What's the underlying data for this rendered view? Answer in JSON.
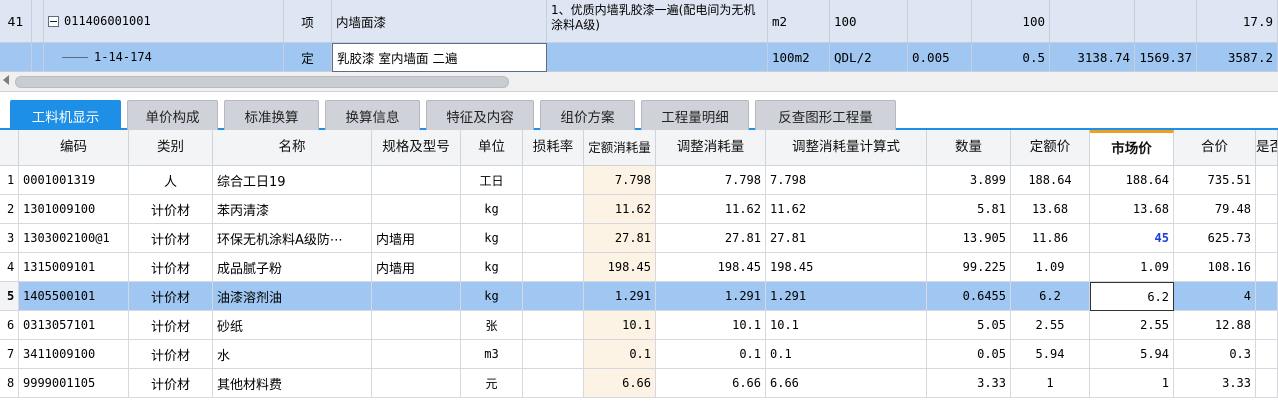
{
  "top_rows": {
    "r41": {
      "rowno": "41",
      "minus": "−",
      "code": "011406001001",
      "kind": "项",
      "name": "内墙面漆",
      "feature": "1、优质内墙乳胶漆一遍(配电间为无机涂料A级)",
      "unit": "m2",
      "qty_expr": "100",
      "qty": "100",
      "total": "17.9"
    },
    "ding": {
      "code": "1-14-174",
      "kind": "定",
      "name": "乳胶漆 室内墙面 二遍",
      "unit": "100m2",
      "qty_expr": "QDL/2",
      "coef": "0.005",
      "qty": "0.5",
      "v1": "3138.74",
      "v2": "1569.37",
      "total": "3587.2"
    }
  },
  "tabs": [
    {
      "label": "工料机显示"
    },
    {
      "label": "单价构成"
    },
    {
      "label": "标准换算"
    },
    {
      "label": "换算信息"
    },
    {
      "label": "特征及内容"
    },
    {
      "label": "组价方案"
    },
    {
      "label": "工程量明细"
    },
    {
      "label": "反查图形工程量"
    }
  ],
  "grid": {
    "headers": {
      "code": "编码",
      "category": "类别",
      "name": "名称",
      "spec": "规格及型号",
      "unit": "单位",
      "loss": "损耗率",
      "quota": "定额消耗量",
      "adj": "调整消耗量",
      "formula": "调整消耗量计算式",
      "qty": "数量",
      "quota_price": "定额价",
      "market_price": "市场价",
      "amount": "合价",
      "extra": "是否"
    },
    "rows": [
      {
        "no": "1",
        "code": "0001001319",
        "category": "人",
        "name": "综合工日19",
        "spec": "",
        "unit": "工日",
        "loss": "",
        "quota": "7.798",
        "adj": "7.798",
        "formula": "7.798",
        "qty": "3.899",
        "quota_price": "188.64",
        "market_price": "188.64",
        "amount": "735.51"
      },
      {
        "no": "2",
        "code": "1301009100",
        "category": "计价材",
        "name": "苯丙清漆",
        "spec": "",
        "unit": "kg",
        "loss": "",
        "quota": "11.62",
        "adj": "11.62",
        "formula": "11.62",
        "qty": "5.81",
        "quota_price": "13.68",
        "market_price": "13.68",
        "amount": "79.48"
      },
      {
        "no": "3",
        "code": "1303002100@1",
        "category": "计价材",
        "name": "环保无机涂料A级防⋯",
        "spec": "内墙用",
        "unit": "kg",
        "loss": "",
        "quota": "27.81",
        "adj": "27.81",
        "formula": "27.81",
        "qty": "13.905",
        "quota_price": "11.86",
        "market_price": "45",
        "amount": "625.73"
      },
      {
        "no": "4",
        "code": "1315009101",
        "category": "计价材",
        "name": "成品腻子粉",
        "spec": "内墙用",
        "unit": "kg",
        "loss": "",
        "quota": "198.45",
        "adj": "198.45",
        "formula": "198.45",
        "qty": "99.225",
        "quota_price": "1.09",
        "market_price": "1.09",
        "amount": "108.16"
      },
      {
        "no": "5",
        "code": "1405500101",
        "category": "计价材",
        "name": "油漆溶剂油",
        "spec": "",
        "unit": "kg",
        "loss": "",
        "quota": "1.291",
        "adj": "1.291",
        "formula": "1.291",
        "qty": "0.6455",
        "quota_price": "6.2",
        "market_price": "6.2",
        "amount": "4"
      },
      {
        "no": "6",
        "code": "0313057101",
        "category": "计价材",
        "name": "砂纸",
        "spec": "",
        "unit": "张",
        "loss": "",
        "quota": "10.1",
        "adj": "10.1",
        "formula": "10.1",
        "qty": "5.05",
        "quota_price": "2.55",
        "market_price": "2.55",
        "amount": "12.88"
      },
      {
        "no": "7",
        "code": "3411009100",
        "category": "计价材",
        "name": "水",
        "spec": "",
        "unit": "m3",
        "loss": "",
        "quota": "0.1",
        "adj": "0.1",
        "formula": "0.1",
        "qty": "0.05",
        "quota_price": "5.94",
        "market_price": "5.94",
        "amount": "0.3"
      },
      {
        "no": "8",
        "code": "9999001105",
        "category": "计价材",
        "name": "其他材料费",
        "spec": "",
        "unit": "元",
        "loss": "",
        "quota": "6.66",
        "adj": "6.66",
        "formula": "6.66",
        "qty": "3.33",
        "quota_price": "1",
        "market_price": "1",
        "amount": "3.33"
      }
    ]
  },
  "colors": {
    "selected_row": "#9fc7f2",
    "active_tab": "#1e8fe6",
    "market_header_accent": "#f0a020",
    "modified_price": "#1a3fd6"
  }
}
